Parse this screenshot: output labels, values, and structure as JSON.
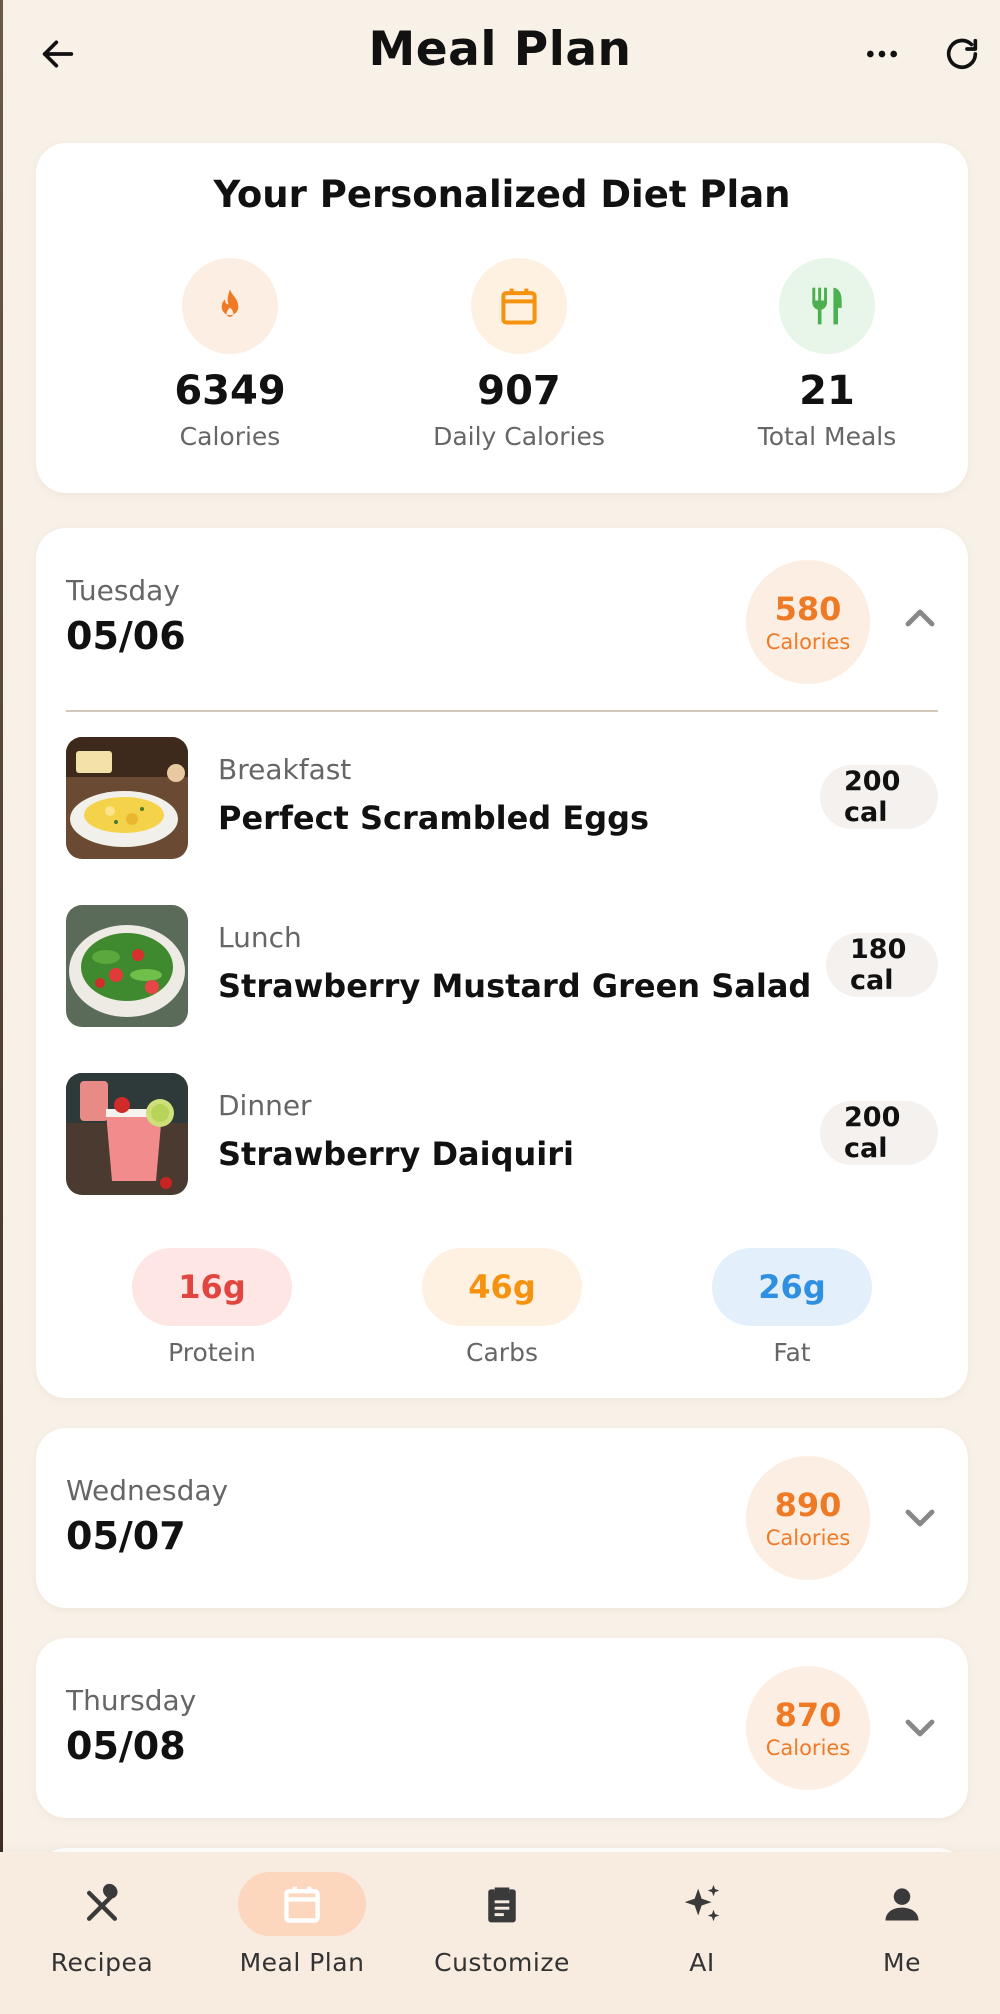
{
  "header": {
    "title": "Meal Plan",
    "back_icon": "arrow-left-icon",
    "more_icon": "more-horizontal-icon",
    "refresh_icon": "refresh-icon"
  },
  "summary": {
    "title": "Your Personalized Diet Plan",
    "stats": [
      {
        "value": "6349",
        "label": "Calories",
        "icon": "flame-icon",
        "color": "#ef7a26",
        "bg": "#fdeee3"
      },
      {
        "value": "907",
        "label": "Daily Calories",
        "icon": "calendar-icon",
        "color": "#f5920f",
        "bg": "#fef1e2"
      },
      {
        "value": "21",
        "label": "Total Meals",
        "icon": "utensils-icon",
        "color": "#4caf50",
        "bg": "#e8f6ea"
      }
    ]
  },
  "days": [
    {
      "day": "Tuesday",
      "date": "05/06",
      "calories": "580",
      "calories_label": "Calories",
      "expanded": true,
      "meals": [
        {
          "type": "Breakfast",
          "name": "Perfect Scrambled Eggs",
          "cal": "200 cal"
        },
        {
          "type": "Lunch",
          "name": "Strawberry Mustard Green Salad",
          "cal": "180 cal"
        },
        {
          "type": "Dinner",
          "name": "Strawberry Daiquiri",
          "cal": "200 cal"
        }
      ],
      "macros": [
        {
          "value": "16g",
          "label": "Protein",
          "color": "#e0463f",
          "bg": "#fde6e4"
        },
        {
          "value": "46g",
          "label": "Carbs",
          "color": "#f5920f",
          "bg": "#fef1e2"
        },
        {
          "value": "26g",
          "label": "Fat",
          "color": "#2f8fe0",
          "bg": "#e3f0fc"
        }
      ]
    },
    {
      "day": "Wednesday",
      "date": "05/07",
      "calories": "890",
      "calories_label": "Calories",
      "expanded": false
    },
    {
      "day": "Thursday",
      "date": "05/08",
      "calories": "870",
      "calories_label": "Calories",
      "expanded": false
    }
  ],
  "nav": {
    "active": "Meal Plan",
    "items": [
      {
        "label": "Recipea",
        "icon": "utensils-crossed-icon"
      },
      {
        "label": "Meal Plan",
        "icon": "calendar-icon"
      },
      {
        "label": "Customize",
        "icon": "clipboard-icon"
      },
      {
        "label": "AI",
        "icon": "sparkles-icon"
      },
      {
        "label": "Me",
        "icon": "person-icon"
      }
    ]
  }
}
